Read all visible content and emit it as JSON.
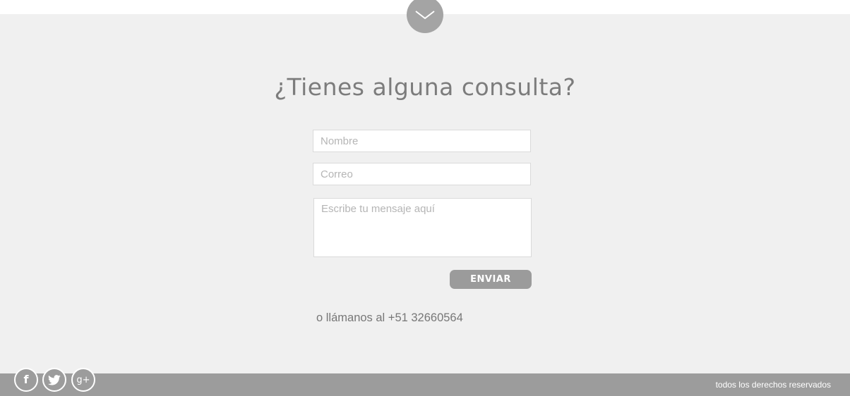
{
  "colors": {
    "page_background": "#f0f0f0",
    "header_strip": "#ffffff",
    "accent_gray": "#9c9c9c",
    "title_text": "#7c7c7c",
    "button_text": "#ffffff"
  },
  "scroll_down": {
    "icon": "chevron-down-icon"
  },
  "contact": {
    "title": "¿Tienes alguna consulta?",
    "name_placeholder": "Nombre",
    "email_placeholder": "Correo",
    "message_placeholder": "Escribe tu mensaje aquí",
    "send_label": "ENVIAR",
    "phone_text": "o llámanos al +51 32660564"
  },
  "footer": {
    "social": [
      {
        "name": "facebook",
        "icon": "facebook-icon",
        "glyph": "f"
      },
      {
        "name": "twitter",
        "icon": "twitter-icon",
        "glyph": "twitter-bird"
      },
      {
        "name": "google-plus",
        "icon": "google-plus-icon",
        "glyph": "g+"
      }
    ],
    "copyright": "todos los derechos reservados"
  }
}
